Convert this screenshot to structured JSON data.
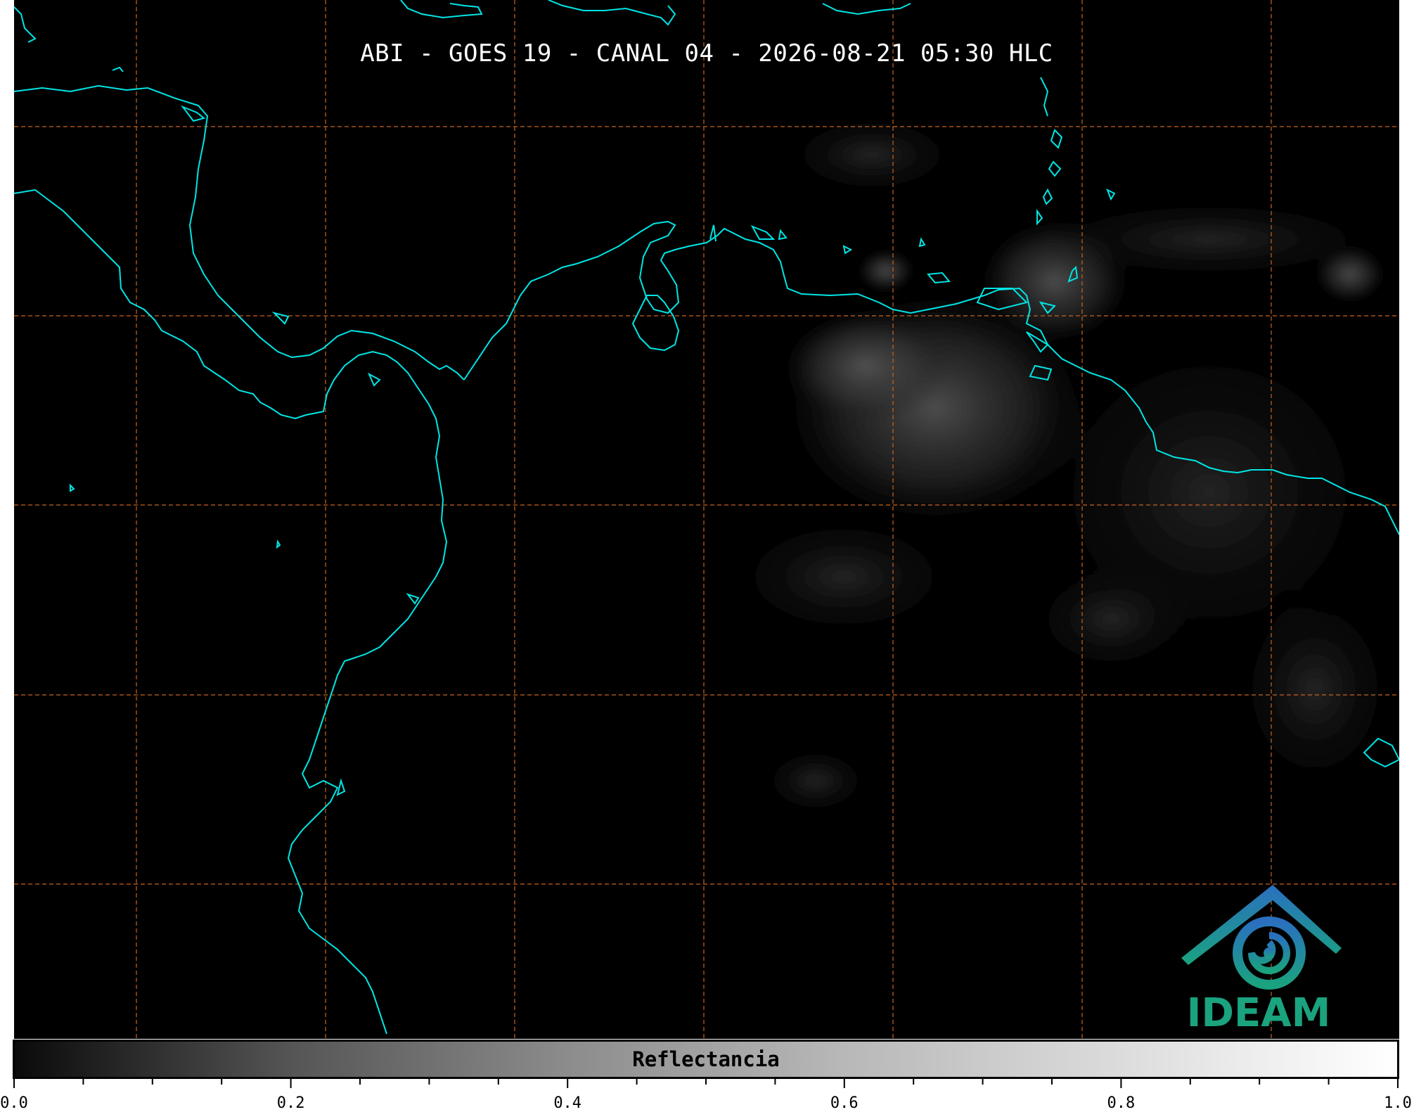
{
  "title": "ABI - GOES 19 - CANAL 04 - 2026-08-21 05:30 HLC",
  "logo": {
    "icon": "ideam-logo-icon",
    "text": "IDEAM"
  },
  "colorbar": {
    "label": "Reflectancia",
    "range": [
      0.0,
      1.0
    ],
    "tick_labels": [
      "0.0",
      "0.2",
      "0.4",
      "0.6",
      "0.8",
      "1.0"
    ],
    "colors": {
      "min": "#000000",
      "max": "#ffffff"
    }
  },
  "map": {
    "background": "#000000",
    "coastline_color": "#00e5e5",
    "grid_color": "#c8641e",
    "grid_style": "dashed"
  }
}
